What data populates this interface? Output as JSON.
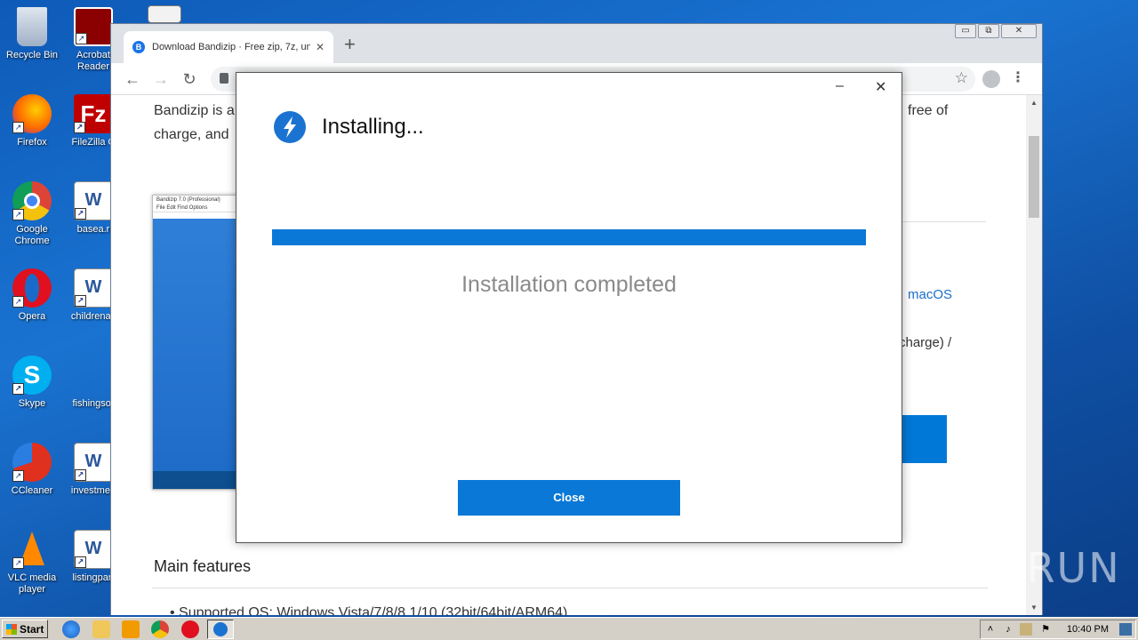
{
  "desktop": {
    "icons": [
      {
        "label": "Recycle Bin"
      },
      {
        "label": "Acrobat Reader"
      },
      {
        "label": "Firefox"
      },
      {
        "label": "FileZilla C"
      },
      {
        "label": "Google Chrome"
      },
      {
        "label": "basea.r"
      },
      {
        "label": "Opera"
      },
      {
        "label": "childrenas"
      },
      {
        "label": "Skype"
      },
      {
        "label": "fishingsor"
      },
      {
        "label": "CCleaner"
      },
      {
        "label": "investmen"
      },
      {
        "label": "VLC media player"
      },
      {
        "label": "listingpart"
      }
    ]
  },
  "browser": {
    "tab_title": "Download Bandizip · Free zip, 7z, un",
    "favicon_letter": "B",
    "new_tab": "+",
    "tab_close": "✕",
    "window_controls": {
      "minimize": "▭",
      "restore": "⧉",
      "close": "✕"
    }
  },
  "page": {
    "intro_line1": "Bandizip is a",
    "intro_line2": "charge, and",
    "right_line1": "free of",
    "macos_link": "macOS",
    "charge_text": "charge) /",
    "screenshot_title": "Bandizip 7.0 (Professional)",
    "screenshot_menu": "File   Edit   Find   Options",
    "main_features_heading": "Main features",
    "bullet_text": "Supported OS: Windows Vista/7/8/8.1/10 (32bit/64bit/ARM64)"
  },
  "dialog": {
    "title": "Installing...",
    "progress_percent": 100,
    "status": "Installation completed",
    "close_label": "Close",
    "minimize_glyph": "–",
    "close_glyph": "✕"
  },
  "watermark": "ANY RUN",
  "taskbar": {
    "start_label": "Start",
    "clock": "10:40 PM"
  },
  "colors": {
    "accent": "#0a78d6",
    "desktop": "#1a73d1",
    "status_text": "#8a8a8a"
  }
}
